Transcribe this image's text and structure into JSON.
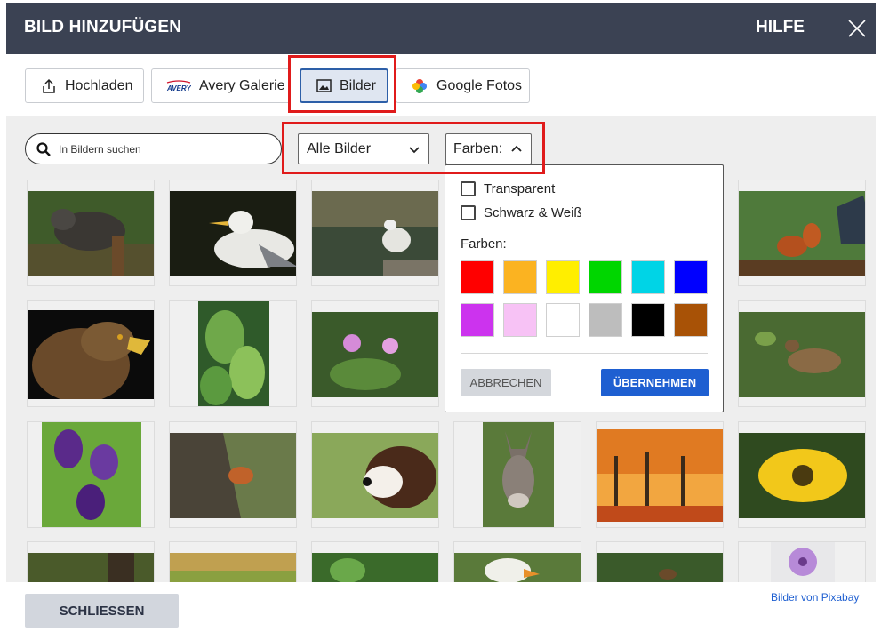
{
  "header": {
    "title": "BILD HINZUFÜGEN",
    "help": "HILFE"
  },
  "tabs": [
    {
      "label": "Hochladen",
      "icon": "upload-icon"
    },
    {
      "label": "Avery Galerie",
      "icon": "avery-logo",
      "logo_text": "AVERY"
    },
    {
      "label": "Bilder",
      "icon": "image-icon",
      "active": true
    },
    {
      "label": "Google Fotos",
      "icon": "google-photos-icon"
    }
  ],
  "search": {
    "placeholder": "In Bildern suchen"
  },
  "filter": {
    "selected": "Alle Bilder"
  },
  "colors_button": {
    "label": "Farben:"
  },
  "popup": {
    "checkbox_transparent": "Transparent",
    "checkbox_bw": "Schwarz & Weiß",
    "colors_label": "Farben:",
    "swatches": [
      "#ff0000",
      "#fbb321",
      "#ffee00",
      "#00d600",
      "#00d4e6",
      "#0000ff",
      "#cc33ee",
      "#f7c2f5",
      "#ffffff",
      "#bdbdbd",
      "#000000",
      "#a85206"
    ],
    "cancel": "ABBRECHEN",
    "apply": "ÜBERNEHMEN"
  },
  "gallery": [
    {
      "subject": "bear"
    },
    {
      "subject": "seagull"
    },
    {
      "subject": "seagull-water"
    },
    {
      "subject": "squirrel-feeder"
    },
    {
      "subject": "eagle"
    },
    {
      "subject": "leaves"
    },
    {
      "subject": "flowers-pink"
    },
    {
      "subject": "duck"
    },
    {
      "subject": "tulips"
    },
    {
      "subject": "squirrel-tree"
    },
    {
      "subject": "dog"
    },
    {
      "subject": "donkey"
    },
    {
      "subject": "autumn-painting"
    },
    {
      "subject": "yellow-flower"
    }
  ],
  "footer": {
    "close": "SCHLIESSEN",
    "credit": "Bilder von Pixabay"
  }
}
